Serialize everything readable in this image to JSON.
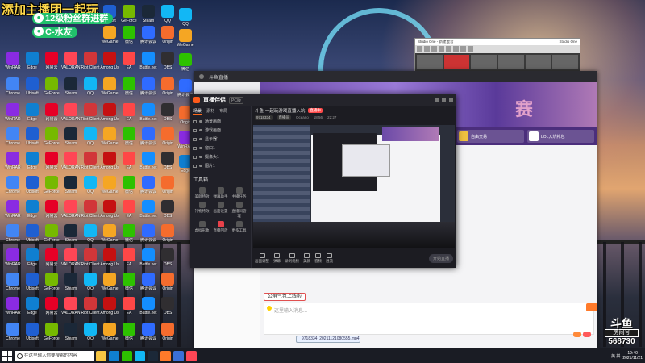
{
  "overlay": {
    "title": "添加主播团一起玩",
    "line1": "12级粉丝群进群",
    "line2": "C-水友"
  },
  "desktop_icons": [
    {
      "label": "Ubisoft",
      "color": "#1f5fd1"
    },
    {
      "label": "GeForce",
      "color": "#76b900"
    },
    {
      "label": "Steam",
      "color": "#1b2838"
    },
    {
      "label": "QQ",
      "color": "#12b7f5"
    },
    {
      "label": "WeGame",
      "color": "#f5a623"
    },
    {
      "label": "微信",
      "color": "#2dc100"
    },
    {
      "label": "腾讯会议",
      "color": "#2f6bff"
    },
    {
      "label": "Origin",
      "color": "#f56c2d"
    },
    {
      "label": "WinRAR",
      "color": "#8a2be2"
    },
    {
      "label": "Edge",
      "color": "#0f7fd1"
    },
    {
      "label": "网易云",
      "color": "#e60026"
    },
    {
      "label": "VALORANT",
      "color": "#ff4655"
    },
    {
      "label": "Riot Client",
      "color": "#d13639"
    },
    {
      "label": "Among Us",
      "color": "#c51111"
    },
    {
      "label": "EA",
      "color": "#ff4747"
    },
    {
      "label": "Battle.net",
      "color": "#148eff"
    },
    {
      "label": "OBS",
      "color": "#302e31"
    },
    {
      "label": "Chrome",
      "color": "#4285f4"
    }
  ],
  "browser": {
    "title": "斗鱼直播",
    "game_cards": [
      {
        "label": "自由交易",
        "thumb": "#f0c040"
      },
      {
        "label": "LOL入坑礼包",
        "thumb": "#ffffff"
      }
    ],
    "chat_pill": "公屏气氛上线啦",
    "chat_placeholder": "这里输入消息...",
    "file_chip": "9718334_20211121080555.mp4"
  },
  "stream_app": {
    "name": "直播伴侣",
    "version": "PC版",
    "tabs": [
      "场景",
      "素材",
      "布局"
    ],
    "scenes": [
      "场景画面",
      "游戏画面",
      "显示器1",
      "窗口1",
      "摄像头1",
      "图片1"
    ],
    "tools_title": "工具箱",
    "tools": [
      "美颜特效",
      "弹幕助手",
      "主播任务",
      "礼物特效",
      "画面设置",
      "直播间管理",
      "虚拟形象",
      "直播回放",
      "更多工具"
    ],
    "room_title": "斗鱼·一起玩游戏直播入坑",
    "live_tag": "直播中",
    "meta": [
      "9718334",
      "直播间",
      "Oceano",
      "18:56",
      "22:27"
    ],
    "bottom_buttons": [
      "画面调整",
      "弹幕",
      "录制视频",
      "美颜",
      "音频",
      "混流"
    ],
    "start_label": "开始直播"
  },
  "small_window": {
    "title": "Studio One - 新建混音",
    "right": "Studio One"
  },
  "taskbar": {
    "search_placeholder": "在这里输入你要搜索的内容",
    "apps": [
      {
        "name": "file-explorer",
        "color": "#f5c542"
      },
      {
        "name": "edge",
        "color": "#0f7fd1"
      },
      {
        "name": "wechat",
        "color": "#2dc100"
      },
      {
        "name": "qq",
        "color": "#12b7f5"
      },
      {
        "name": "steam",
        "color": "#1b2838"
      },
      {
        "name": "douyu",
        "color": "#ff7a2a"
      },
      {
        "name": "studio-one",
        "color": "#3a6fd8"
      },
      {
        "name": "valorant",
        "color": "#ff4655"
      }
    ],
    "tray": "英 拼",
    "time": "19:40",
    "date": "2021/11/21"
  },
  "watermark": {
    "logo": "斗鱼",
    "tag": "房间号",
    "room_number": "568730"
  }
}
